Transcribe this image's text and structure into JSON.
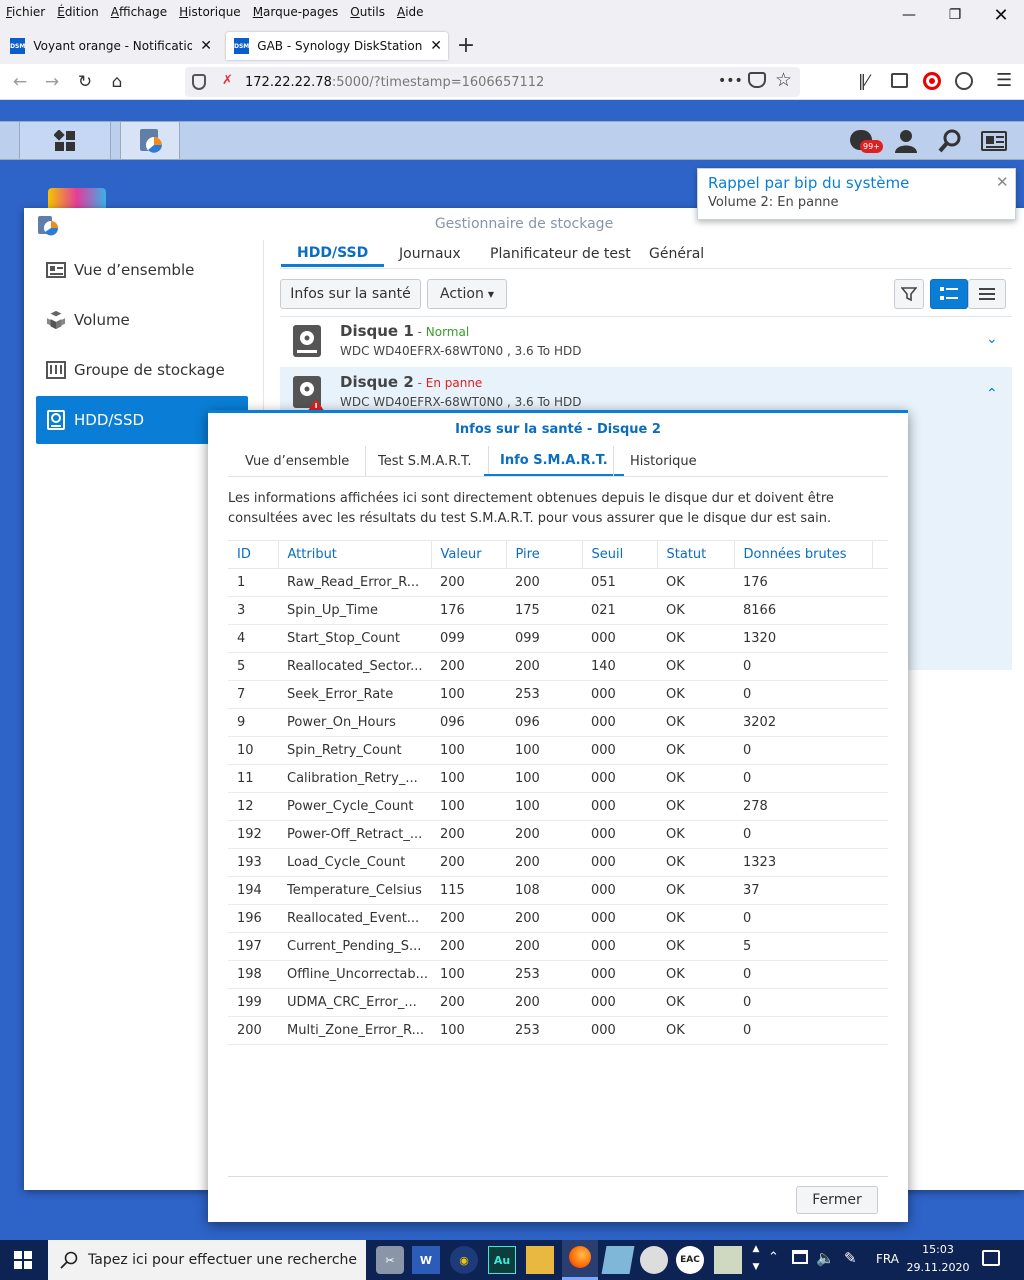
{
  "browser": {
    "menu": [
      "Fichier",
      "Édition",
      "Affichage",
      "Historique",
      "Marque-pages",
      "Outils",
      "Aide"
    ],
    "tabs": [
      {
        "fav": "DSM",
        "title": "Voyant orange - Notification - I"
      },
      {
        "fav": "DSM",
        "title": "GAB - Synology DiskStation"
      }
    ],
    "url_host": "172.22.22.78",
    "url_rest": ":5000/?timestamp=1606657112",
    "url_dots": "•••"
  },
  "dsm": {
    "badge": "99+"
  },
  "toast": {
    "title": "Rappel par bip du système",
    "message": "Volume 2: En panne"
  },
  "storage": {
    "title": "Gestionnaire de stockage",
    "sidebar": [
      {
        "label": "Vue d’ensemble",
        "icon": "overview-icon"
      },
      {
        "label": "Volume",
        "icon": "volume-icon"
      },
      {
        "label": "Groupe de stockage",
        "icon": "storage-pool-icon"
      },
      {
        "label": "HDD/SSD",
        "icon": "hdd-icon"
      }
    ],
    "tabs": [
      "HDD/SSD",
      "Journaux",
      "Planificateur de test",
      "Général"
    ],
    "health_button": "Infos sur la santé",
    "action_button": "Action",
    "disks": [
      {
        "name": "Disque 1",
        "sep": " - ",
        "status": "Normal",
        "status_color": "#3c9a2e",
        "model": "WDC WD40EFRX-68WT0N0 , 3.6 To HDD"
      },
      {
        "name": "Disque 2",
        "sep": " - ",
        "status": "En panne",
        "status_color": "#e02020",
        "model": "WDC WD40EFRX-68WT0N0 , 3.6 To HDD"
      }
    ]
  },
  "dialog": {
    "title": "Infos sur la santé - Disque 2",
    "tabs": [
      "Vue d’ensemble",
      "Test S.M.A.R.T.",
      "Info S.M.A.R.T.",
      "Historique"
    ],
    "description": "Les informations affichées ici sont directement obtenues depuis le disque dur et doivent être consultées avec les résultats du test S.M.A.R.T. pour vous assurer que le disque dur est sain.",
    "columns": [
      "ID",
      "Attribut",
      "Valeur",
      "Pire",
      "Seuil",
      "Statut",
      "Données brutes"
    ],
    "rows": [
      [
        "1",
        "Raw_Read_Error_R...",
        "200",
        "200",
        "051",
        "OK",
        "176"
      ],
      [
        "3",
        "Spin_Up_Time",
        "176",
        "175",
        "021",
        "OK",
        "8166"
      ],
      [
        "4",
        "Start_Stop_Count",
        "099",
        "099",
        "000",
        "OK",
        "1320"
      ],
      [
        "5",
        "Reallocated_Sector...",
        "200",
        "200",
        "140",
        "OK",
        "0"
      ],
      [
        "7",
        "Seek_Error_Rate",
        "100",
        "253",
        "000",
        "OK",
        "0"
      ],
      [
        "9",
        "Power_On_Hours",
        "096",
        "096",
        "000",
        "OK",
        "3202"
      ],
      [
        "10",
        "Spin_Retry_Count",
        "100",
        "100",
        "000",
        "OK",
        "0"
      ],
      [
        "11",
        "Calibration_Retry_...",
        "100",
        "100",
        "000",
        "OK",
        "0"
      ],
      [
        "12",
        "Power_Cycle_Count",
        "100",
        "100",
        "000",
        "OK",
        "278"
      ],
      [
        "192",
        "Power-Off_Retract_...",
        "200",
        "200",
        "000",
        "OK",
        "0"
      ],
      [
        "193",
        "Load_Cycle_Count",
        "200",
        "200",
        "000",
        "OK",
        "1323"
      ],
      [
        "194",
        "Temperature_Celsius",
        "115",
        "108",
        "000",
        "OK",
        "37"
      ],
      [
        "196",
        "Reallocated_Event...",
        "200",
        "200",
        "000",
        "OK",
        "0"
      ],
      [
        "197",
        "Current_Pending_S...",
        "200",
        "200",
        "000",
        "OK",
        "5"
      ],
      [
        "198",
        "Offline_Uncorrectab...",
        "100",
        "253",
        "000",
        "OK",
        "0"
      ],
      [
        "199",
        "UDMA_CRC_Error_...",
        "200",
        "200",
        "000",
        "OK",
        "0"
      ],
      [
        "200",
        "Multi_Zone_Error_R...",
        "100",
        "253",
        "000",
        "OK",
        "0"
      ]
    ],
    "close_button": "Fermer"
  },
  "windows": {
    "search_placeholder": "Tapez ici pour effectuer une recherche",
    "taskbar_apps": [
      "W",
      "Au",
      "EAC"
    ],
    "lang": "FRA",
    "time": "15:03",
    "date": "29.11.2020"
  },
  "colors": {
    "accent": "#0a7ed6",
    "error": "#e02020",
    "ok": "#3c9a2e",
    "desktop": "#2e64c8"
  }
}
